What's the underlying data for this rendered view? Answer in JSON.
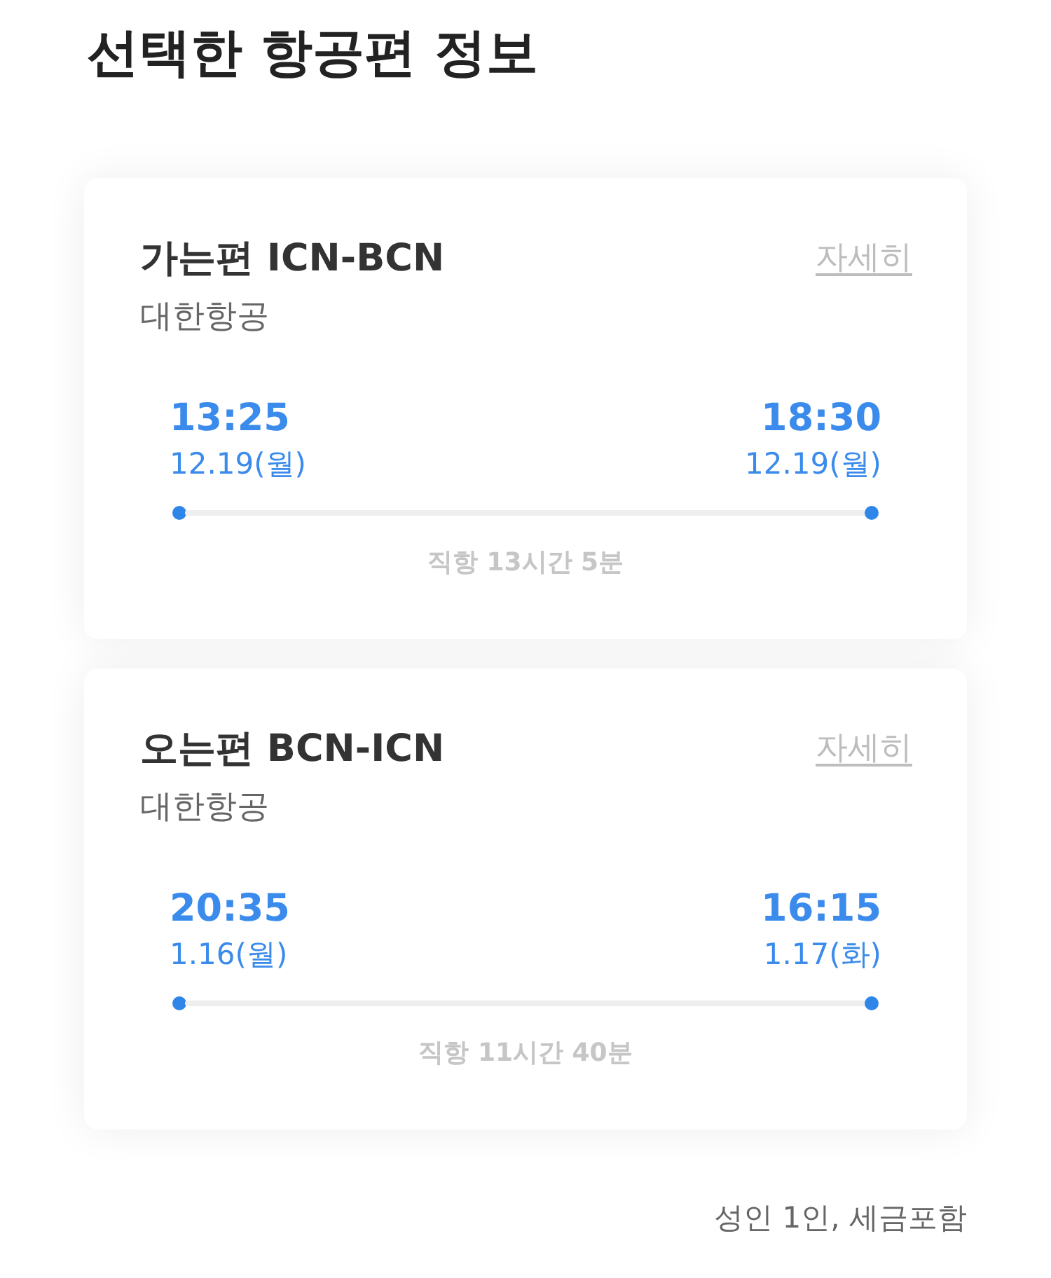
{
  "title": "선택한 항공편 정보",
  "flights": [
    {
      "heading": "가는편 ICN-BCN",
      "airline": "대한항공",
      "details_link": "자세히",
      "departure": {
        "time": "13:25",
        "date": "12.19(월)"
      },
      "arrival": {
        "time": "18:30",
        "date": "12.19(월)"
      },
      "duration": "직항 13시간 5분"
    },
    {
      "heading": "오는편 BCN-ICN",
      "airline": "대한항공",
      "details_link": "자세히",
      "departure": {
        "time": "20:35",
        "date": "1.16(월)"
      },
      "arrival": {
        "time": "16:15",
        "date": "1.17(화)"
      },
      "duration": "직항 11시간 40분"
    }
  ],
  "price_note": "성인 1인, 세금포함"
}
